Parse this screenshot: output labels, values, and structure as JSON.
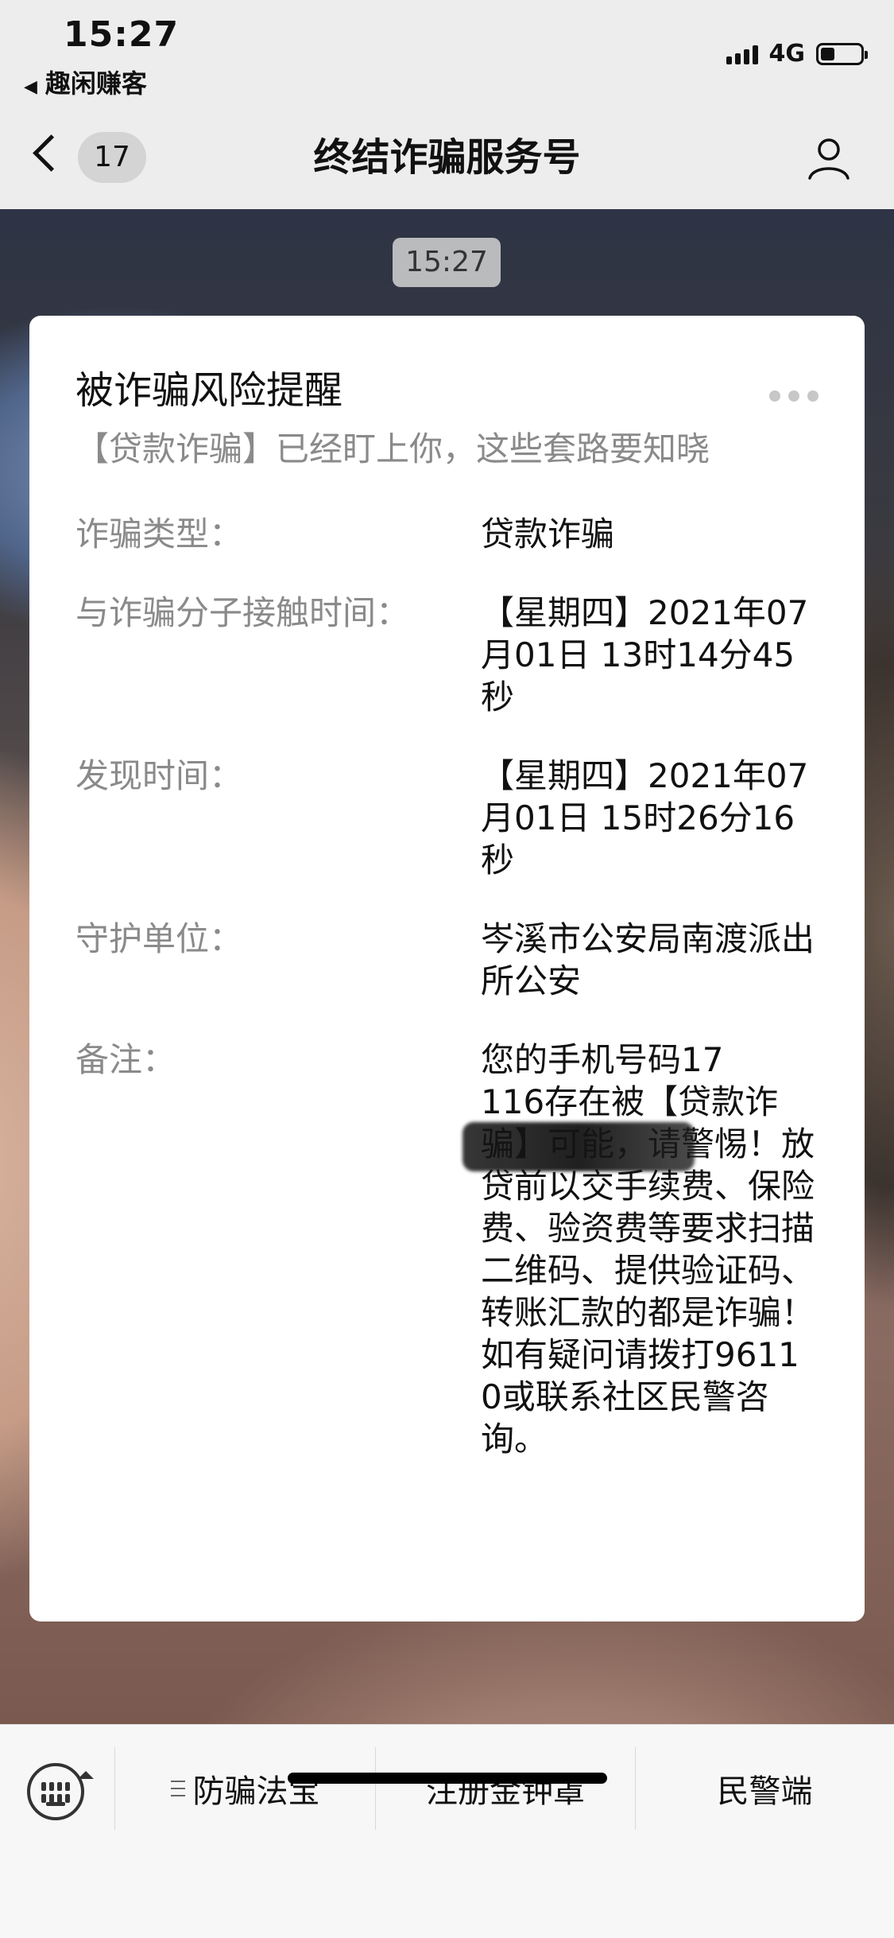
{
  "status_bar": {
    "time": "15:27",
    "back_app": "趣闲赚客",
    "network": "4G"
  },
  "nav": {
    "unread_count": "17",
    "title": "终结诈骗服务号"
  },
  "chat": {
    "timestamp": "15:27"
  },
  "card": {
    "title": "被诈骗风险提醒",
    "subtitle": "【贷款诈骗】已经盯上你，这些套路要知晓",
    "fields": [
      {
        "label": "诈骗类型：",
        "value": "贷款诈骗"
      },
      {
        "label": "与诈骗分子接触时间：",
        "value": "【星期四】2021年07月01日 13时14分45秒"
      },
      {
        "label": "发现时间：",
        "value": "【星期四】2021年07月01日 15时26分16秒"
      },
      {
        "label": "守护单位：",
        "value": "岑溪市公安局南渡派出所公安"
      },
      {
        "label": "备注：",
        "value": "您的手机号码17　　　　116存在被【贷款诈骗】可能，请警惕！放贷前以交手续费、保险费、验资费等要求扫描二维码、提供验证码、转账汇款的都是诈骗！如有疑问请拨打96110或联系社区民警咨询。"
      }
    ]
  },
  "menu": {
    "items": [
      {
        "label": "防骗法宝"
      },
      {
        "label": "注册金钟罩"
      },
      {
        "label": "民警端"
      }
    ]
  },
  "icons": {
    "back": "chevron-left-icon",
    "profile": "user-icon",
    "keyboard": "keyboard-icon",
    "more": "more-dots-icon",
    "submenu": "submenu-lines-icon"
  },
  "colors": {
    "topbar": "#ededed",
    "card": "#ffffff",
    "muted_text": "#8a8a8a",
    "text": "#111111"
  }
}
